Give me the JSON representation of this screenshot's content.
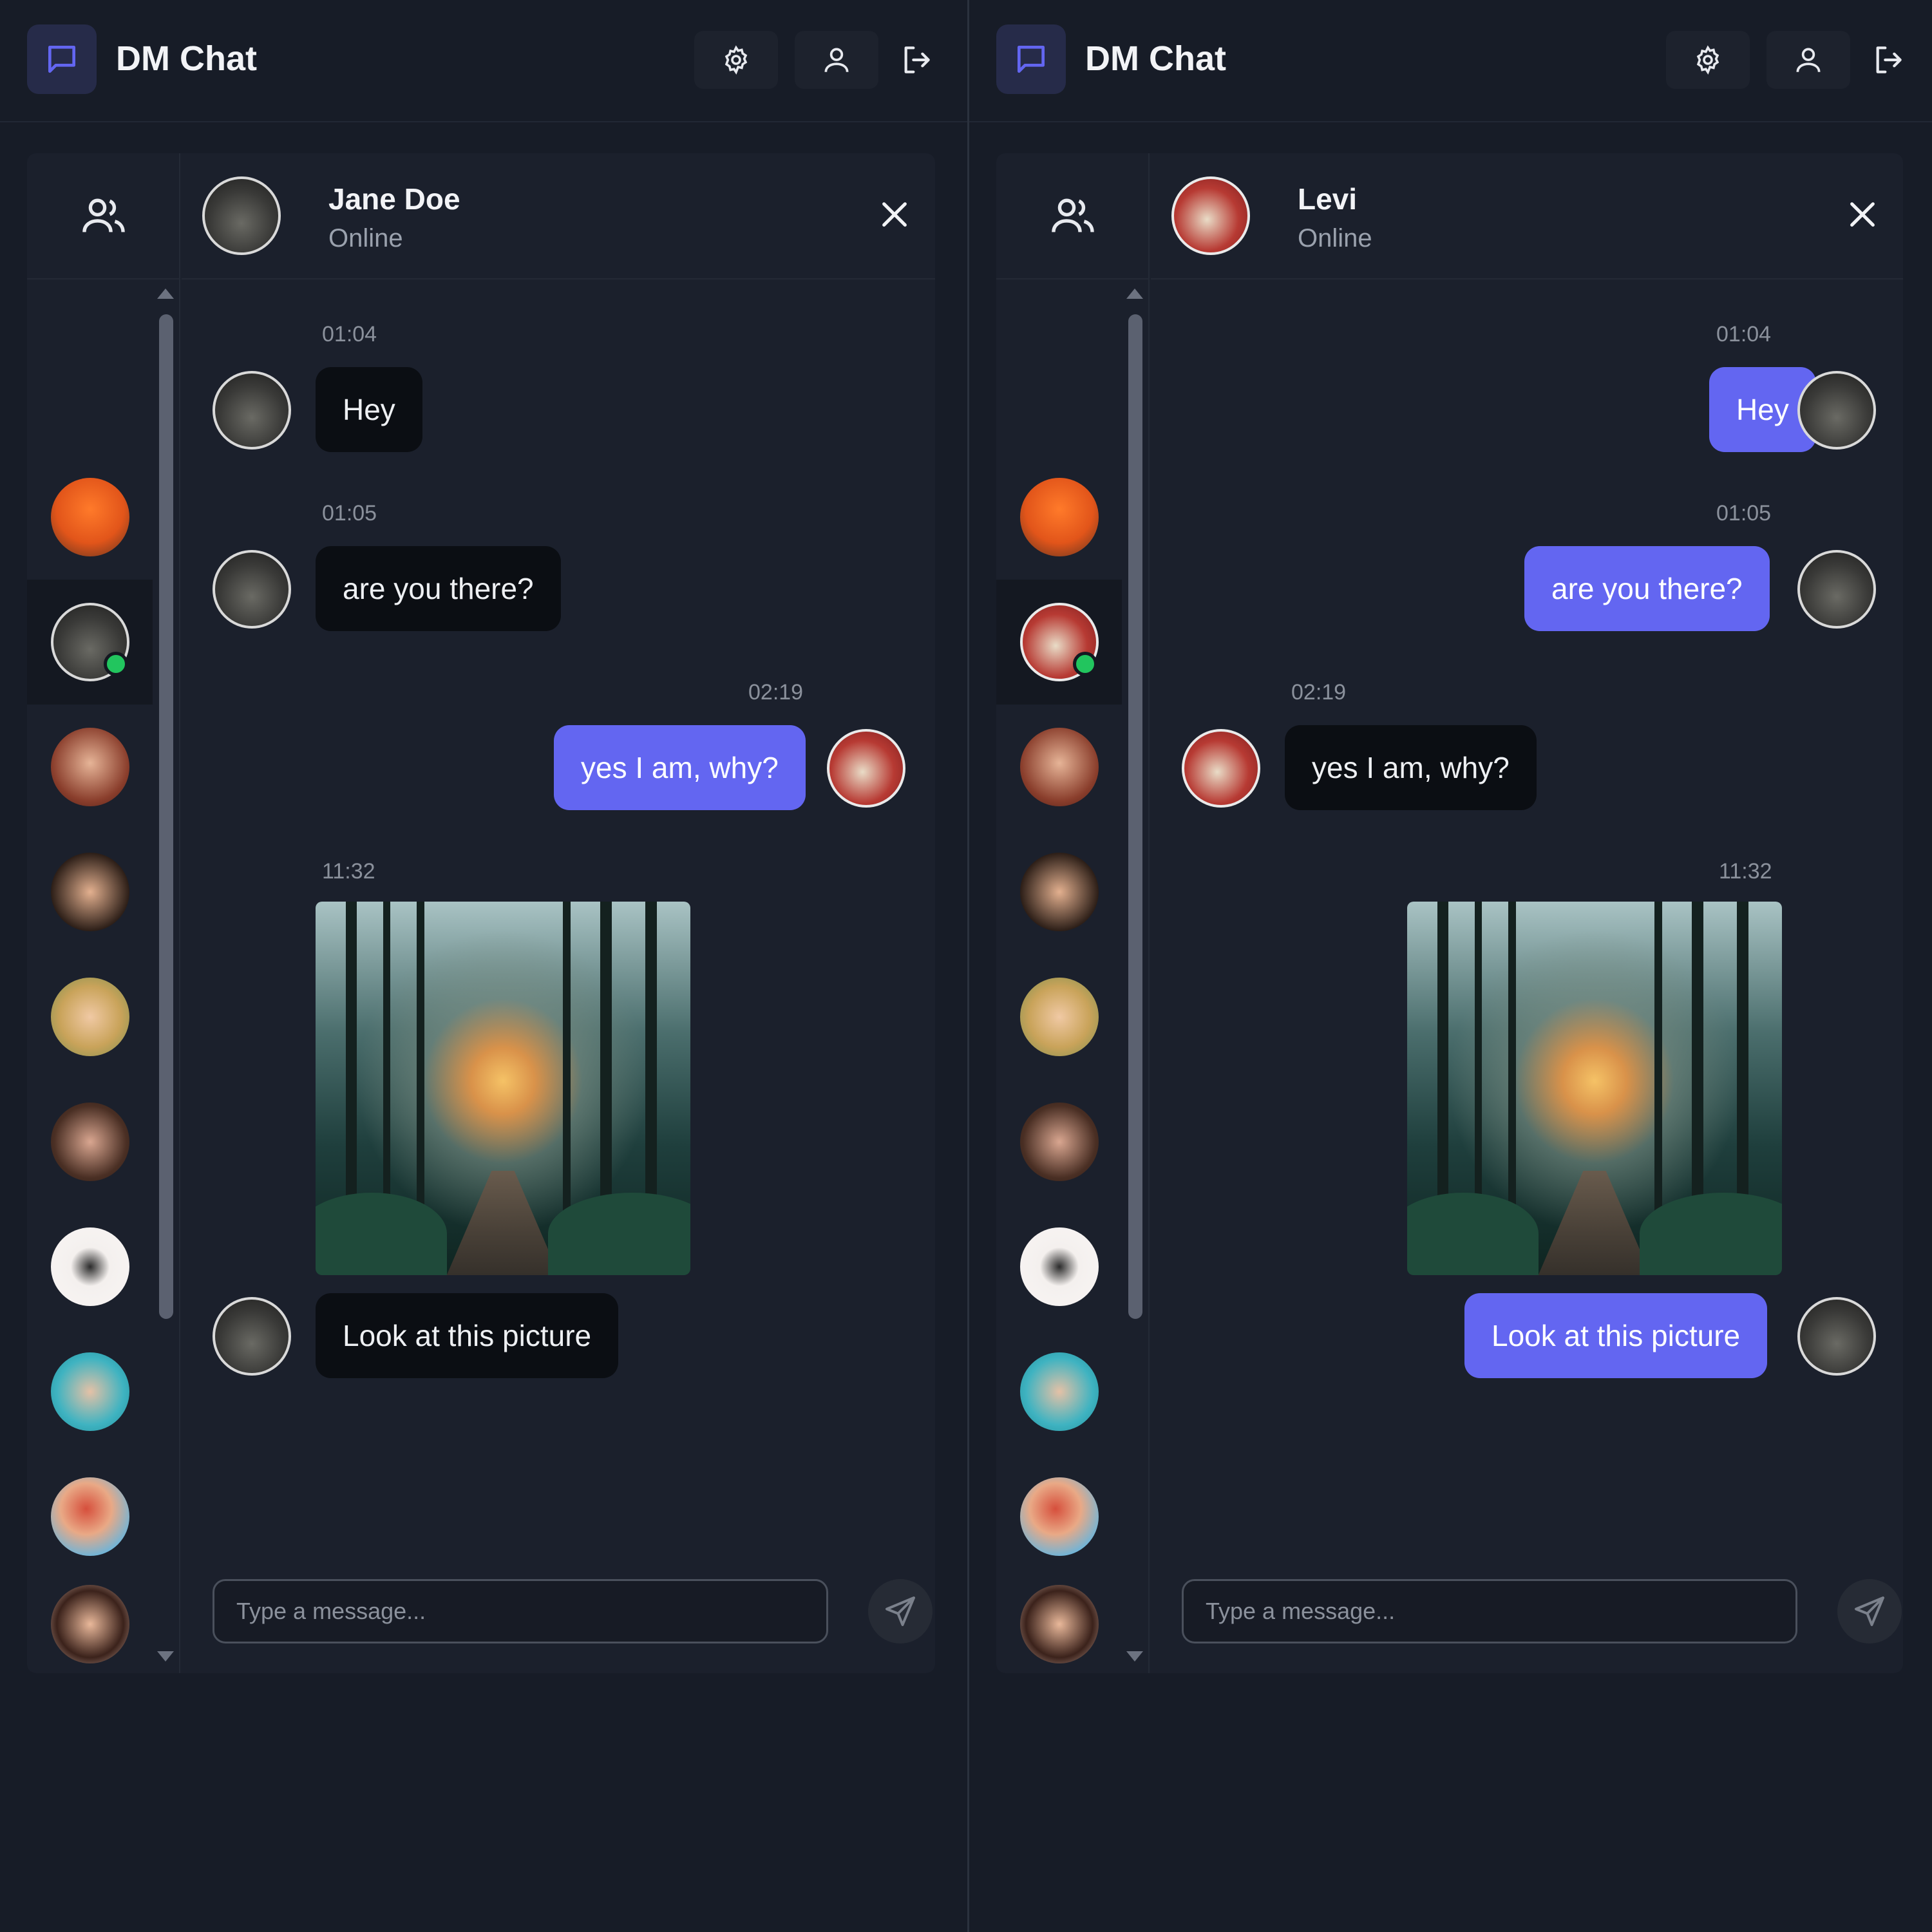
{
  "app": {
    "title": "DM Chat",
    "colors": {
      "background": "#171c27",
      "accent": "#6366f1",
      "incoming": "#0b0e13",
      "online": "#22c55e"
    },
    "icons": {
      "logo": "chat-bubble-icon",
      "settings": "gear-icon",
      "profile": "user-icon",
      "logout": "logout-icon",
      "contacts": "users-icon",
      "close": "close-icon",
      "send": "send-icon"
    }
  },
  "panes": [
    {
      "peer": {
        "name": "Jane Doe",
        "status": "Online"
      },
      "input_placeholder": "Type a message...",
      "messages": [
        {
          "time": "01:04",
          "text": "Hey",
          "direction": "incoming"
        },
        {
          "time": "01:05",
          "text": "are you there?",
          "direction": "incoming"
        },
        {
          "time": "02:19",
          "text": "yes I am, why?",
          "direction": "outgoing"
        },
        {
          "time": "11:32",
          "image": "forest path photo",
          "direction": "incoming"
        },
        {
          "text": "Look at this picture",
          "direction": "incoming"
        }
      ]
    },
    {
      "peer": {
        "name": "Levi",
        "status": "Online"
      },
      "input_placeholder": "Type a message...",
      "messages": [
        {
          "time": "01:04",
          "text": "Hey",
          "direction": "outgoing"
        },
        {
          "time": "01:05",
          "text": "are you there?",
          "direction": "outgoing"
        },
        {
          "time": "02:19",
          "text": "yes I am, why?",
          "direction": "incoming"
        },
        {
          "time": "11:32",
          "image": "forest path photo",
          "direction": "outgoing"
        },
        {
          "text": "Look at this picture",
          "direction": "outgoing"
        }
      ]
    }
  ]
}
